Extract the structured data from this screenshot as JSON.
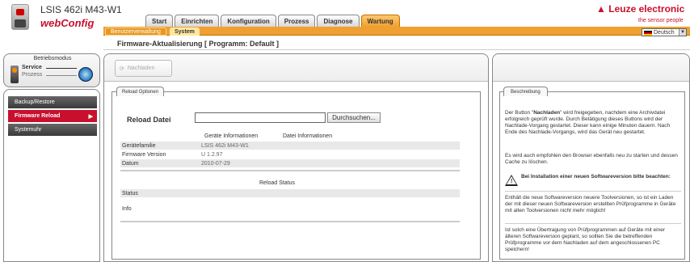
{
  "header": {
    "device_name": "LSIS 462i M43-W1",
    "app_name": "webConfig",
    "brand": "Leuze electronic",
    "brand_symbol": "▲",
    "tagline": "the sensor people",
    "brand_color": "#c8102e",
    "language": "Deutsch",
    "tabs": [
      "Start",
      "Einrichten",
      "Konfiguration",
      "Prozess",
      "Diagnose",
      "Wartung"
    ],
    "active_tab": "Wartung",
    "subtabs": [
      "Benutzerverwaltung",
      "System"
    ],
    "active_subtab": "System"
  },
  "title": "Firmware-Aktualisierung   [ Programm: Default ]",
  "mode": {
    "title": "Betriebsmodus",
    "service": "Service",
    "prozess": "Prozess"
  },
  "nav": {
    "items": [
      "Backup/Restore",
      "Firmware Reload",
      "Systemuhr"
    ],
    "active": "Firmware Reload"
  },
  "toolbar": {
    "reload_label": "Nachladen"
  },
  "reload": {
    "tab": "Reload Optionen",
    "file_label": "Reload Datei",
    "browse_label": "Durchsuchen...",
    "col_device": "Geräte Informationen",
    "col_file": "Datei Informationen",
    "rows": [
      {
        "label": "Gerätefamilie",
        "value": "LSIS 462i M43-W1"
      },
      {
        "label": "Firmware Version",
        "value": "U 1.2.97"
      },
      {
        "label": "Datum",
        "value": "2010-07-29"
      }
    ],
    "status_head": "Reload Status",
    "status_label": "Status",
    "info_label": "Info"
  },
  "description": {
    "tab": "Beschreibung",
    "p1_bold": "Nachladen",
    "p1_pre": "Der Button \"",
    "p1_post": "\" wird freigegeben, nachdem eine Archivdatei erfolgreich geprüft wurde. Durch Betätigung dieses Buttons wird der Nachlade-Vorgang gestartet. Dieser kann einige Minuten dauern. Nach Ende des Nachlade-Vorgangs, wird das Gerät neu gestartet.",
    "p2": "Es wird auch empfohlen den Browser ebenfalls neu zu starten und dessen Cache zu löschen.",
    "warning": "Bei Installation einer neuen Softwareversion bitte beachten:",
    "p3": "Enthält die neue Softwareversion neuere Toolversionen, so ist ein Laden der mit dieser neuen Softwareversion erstellten Prüfprogramme in Geräte mit alten Toolversionen nicht mehr möglich!",
    "p4": "Ist solch eine Übertragung von Prüfprogrammen auf Geräte mit einer älteren Softwareversion geplant, so sollten Sie die betreffenden Prüfprogramme vor dem Nachladen auf dem angeschlossenen PC speichern!"
  }
}
